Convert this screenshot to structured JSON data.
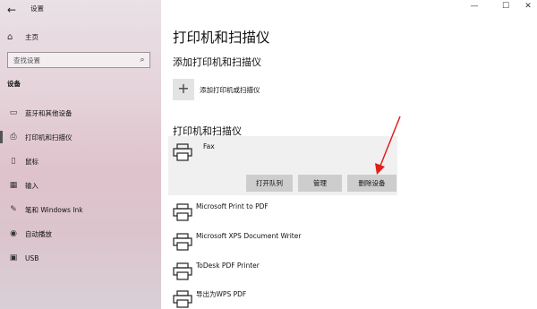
{
  "window": {
    "title": "设置",
    "minimize": "—",
    "maximize": "☐",
    "close": "✕"
  },
  "sidebar": {
    "home_label": "主页",
    "search_placeholder": "查找设置",
    "section_title": "设备",
    "items": [
      {
        "label": "蓝牙和其他设备",
        "icon": "bluetooth-devices-icon"
      },
      {
        "label": "打印机和扫描仪",
        "icon": "printer-icon"
      },
      {
        "label": "鼠标",
        "icon": "mouse-icon"
      },
      {
        "label": "输入",
        "icon": "keyboard-icon"
      },
      {
        "label": "笔和 Windows Ink",
        "icon": "pen-icon"
      },
      {
        "label": "自动播放",
        "icon": "autoplay-icon"
      },
      {
        "label": "USB",
        "icon": "usb-icon"
      }
    ],
    "active_index": 1
  },
  "main": {
    "page_title": "打印机和扫描仪",
    "add_section_title": "添加打印机和扫描仪",
    "add_label": "添加打印机或扫描仪",
    "list_title": "打印机和扫描仪",
    "selected_device": {
      "name": "Fax",
      "buttons": {
        "open_queue": "打开队列",
        "manage": "管理",
        "remove": "删除设备"
      }
    },
    "devices": [
      "Microsoft Print to PDF",
      "Microsoft XPS Document Writer",
      "ToDesk PDF Printer",
      "导出为WPS PDF"
    ]
  },
  "colors": {
    "annotation_arrow": "#e0201b",
    "selected_bg": "#f0f0f0",
    "button_bg": "#cdcdcd"
  }
}
